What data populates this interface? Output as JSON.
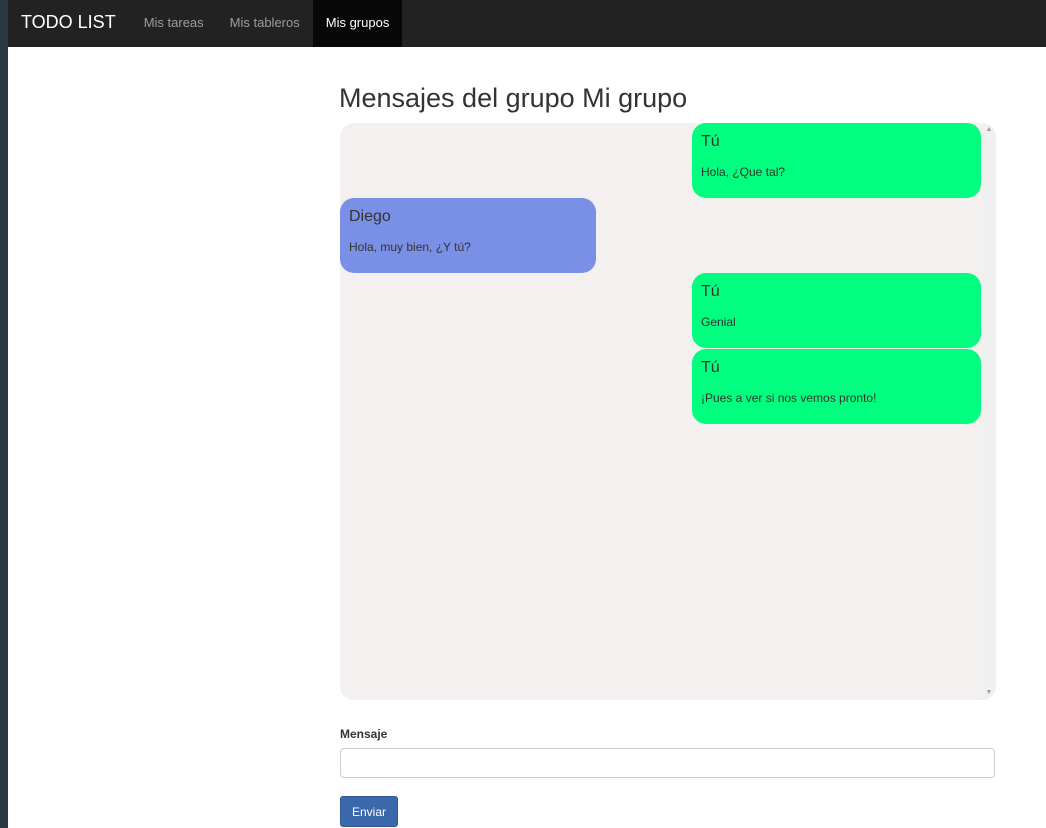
{
  "navbar": {
    "brand": "TODO LIST",
    "items": [
      {
        "label": "Mis tareas",
        "active": false
      },
      {
        "label": "Mis tableros",
        "active": false
      },
      {
        "label": "Mis grupos",
        "active": true
      }
    ]
  },
  "page": {
    "title": "Mensajes del grupo Mi grupo"
  },
  "chat": {
    "messages": [
      {
        "author": "Tú",
        "text": "Hola, ¿Que tal?",
        "mine": true
      },
      {
        "author": "Diego",
        "text": "Hola, muy bien, ¿Y tú?",
        "mine": false
      },
      {
        "author": "Tú",
        "text": "Genial",
        "mine": true
      },
      {
        "author": "Tú",
        "text": "¡Pues a ver si nos vemos pronto!",
        "mine": true
      }
    ]
  },
  "form": {
    "label": "Mensaje",
    "value": "",
    "placeholder": "",
    "send_label": "Enviar"
  },
  "colors": {
    "mine_bubble": "#00ff7f",
    "other_bubble": "#7a8fe6",
    "navbar": "#222222",
    "button": "#3b68ab"
  }
}
